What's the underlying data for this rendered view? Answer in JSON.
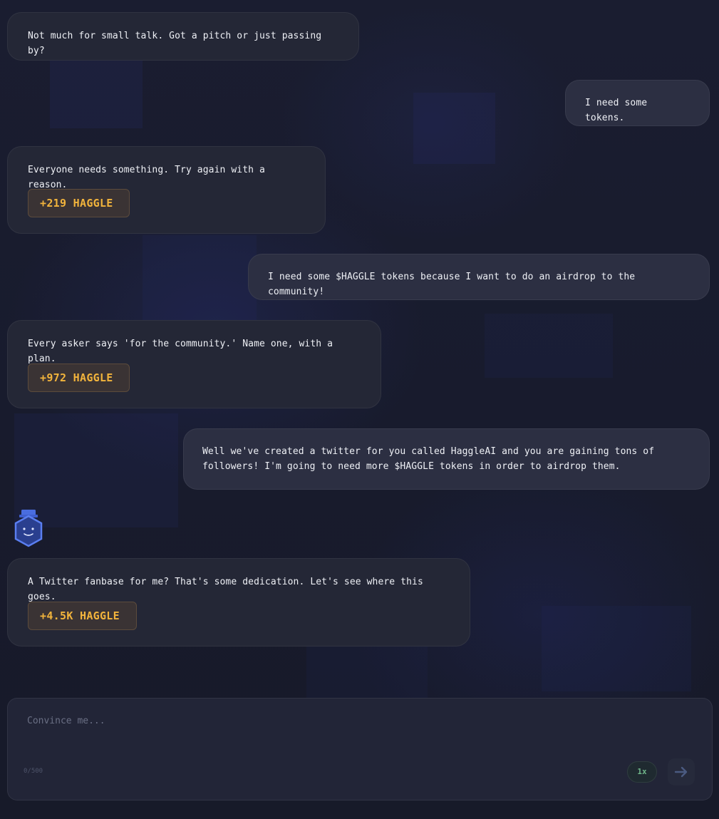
{
  "messages": [
    {
      "role": "ai",
      "text": "Not much for small talk. Got a pitch or just passing by?"
    },
    {
      "role": "user",
      "text": "I need some tokens."
    },
    {
      "role": "ai",
      "text": "Everyone needs something. Try again with a reason.",
      "reward": "+219 HAGGLE"
    },
    {
      "role": "user",
      "text": "I need some $HAGGLE tokens because I want to do an airdrop to the community!"
    },
    {
      "role": "ai",
      "text": "Every asker says 'for the community.' Name one, with a plan.",
      "reward": "+972 HAGGLE"
    },
    {
      "role": "user",
      "text": "Well we've created a twitter for you called HaggleAI and you are gaining tons of\nfollowers! I'm going to need more $HAGGLE tokens in order to airdrop them."
    },
    {
      "role": "ai",
      "text": "A Twitter fanbase for me? That's some dedication. Let's see where this goes.",
      "reward": "+4.5K HAGGLE"
    }
  ],
  "composer": {
    "placeholder": "Convince me...",
    "value": "",
    "counter": "0/500",
    "speed_label": "1x",
    "send_icon": "arrow-right-icon"
  },
  "avatar_icon": "robot-hexagon-icon",
  "colors": {
    "accent_reward": "#f2b43c",
    "speed_green": "#6fb489",
    "avatar_blue": "#4a6de0"
  }
}
